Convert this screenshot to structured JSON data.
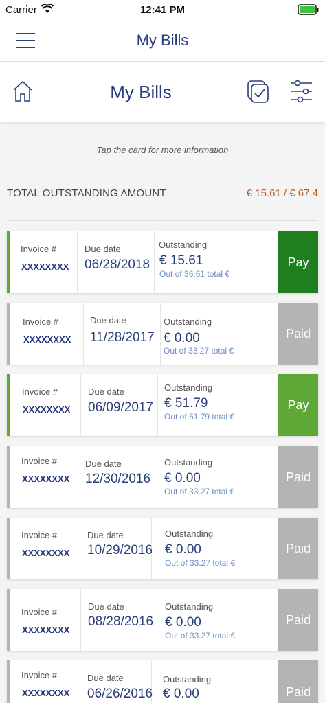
{
  "status_bar": {
    "carrier": "Carrier",
    "time": "12:41 PM"
  },
  "nav": {
    "title": "My Bills"
  },
  "header": {
    "title": "My Bills"
  },
  "hint": "Tap the card for more information",
  "total": {
    "label": "TOTAL OUTSTANDING AMOUNT",
    "value": "€ 15.61 / € 67.4"
  },
  "labels": {
    "invoice": "Invoice #",
    "due_date": "Due date",
    "outstanding": "Outstanding"
  },
  "colors": {
    "pay_dark": "#1f7f1f",
    "pay_light": "#5ea838",
    "paid": "#b4b4b4",
    "accent_pay": "#5ea838",
    "accent_paid": "#b4b4b4",
    "title_blue": "#2a3f7a",
    "total_orange": "#b85a1e"
  },
  "bills": [
    {
      "invoice": "XXXXXXXX",
      "due_date": "06/28/2018",
      "outstanding": "€ 15.61",
      "out_of": "Out of 36.61 total €",
      "action": "Pay",
      "status": "pay-dark"
    },
    {
      "invoice": "XXXXXXXX",
      "due_date": "11/28/2017",
      "outstanding": "€ 0.00",
      "out_of": "Out of 33.27 total €",
      "action": "Paid",
      "status": "paid"
    },
    {
      "invoice": "XXXXXXXX",
      "due_date": "06/09/2017",
      "outstanding": "€ 51.79",
      "out_of": "Out of 51.79 total €",
      "action": "Pay",
      "status": "pay-light"
    },
    {
      "invoice": "XXXXXXXX",
      "due_date": "12/30/2016",
      "outstanding": "€ 0.00",
      "out_of": "Out of 33.27 total €",
      "action": "Paid",
      "status": "paid"
    },
    {
      "invoice": "XXXXXXXX",
      "due_date": "10/29/2016",
      "outstanding": "€ 0.00",
      "out_of": "Out of 33.27 total €",
      "action": "Paid",
      "status": "paid"
    },
    {
      "invoice": "XXXXXXXX",
      "due_date": "08/28/2016",
      "outstanding": "€ 0.00",
      "out_of": "Out of 33.27 total €",
      "action": "Paid",
      "status": "paid"
    },
    {
      "invoice": "XXXXXXXX",
      "due_date": "06/26/2016",
      "outstanding": "€ 0.00",
      "out_of": "",
      "action": "Paid",
      "status": "paid"
    }
  ],
  "icons": {
    "menu": "hamburger-icon",
    "home": "home-icon",
    "select": "multi-select-check-icon",
    "filter": "sliders-icon",
    "wifi": "wifi-icon",
    "battery": "battery-icon"
  }
}
